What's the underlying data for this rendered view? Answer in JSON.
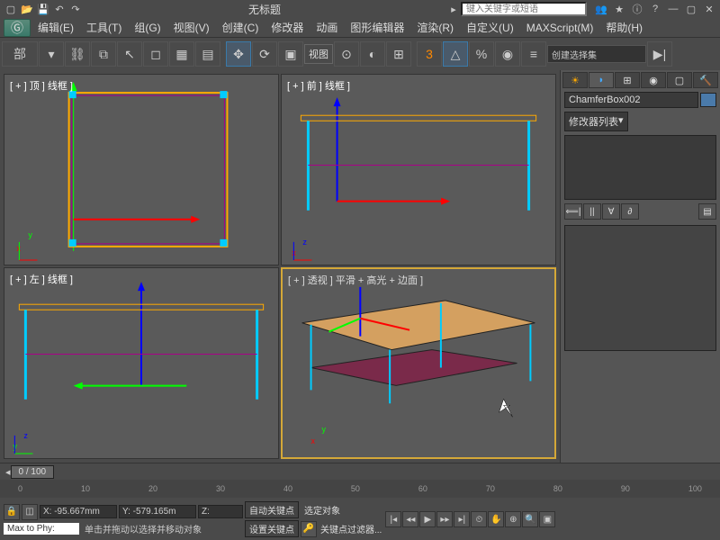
{
  "title": "无标题",
  "search_placeholder": "键入关键字或短语",
  "menus": [
    "编辑(E)",
    "工具(T)",
    "组(G)",
    "视图(V)",
    "创建(C)",
    "修改器",
    "动画",
    "图形编辑器",
    "渲染(R)",
    "自定义(U)",
    "MAXScript(M)",
    "帮助(H)"
  ],
  "toolbar_dropdown_label": "部",
  "view_label": "视图",
  "selection_set": "创建选择集",
  "viewports": {
    "top": "[ + ] 顶 ] 线框 ]",
    "front": "[ + ] 前 ] 线框 ]",
    "left": "[ + ] 左 ] 线框 ]",
    "persp": "[ + ] 透视 ] 平滑 + 高光 + 边面 ]"
  },
  "cmdpanel": {
    "object_name": "ChamferBox002",
    "modifier_list": "修改器列表"
  },
  "timeline": {
    "pos": "0 / 100",
    "ticks": [
      "0",
      "10",
      "20",
      "30",
      "40",
      "50",
      "60",
      "70",
      "80",
      "90",
      "100"
    ]
  },
  "status": {
    "x": "X: -95.667mm",
    "y": "Y: -579.165m",
    "z": "Z:",
    "script": "Max to Phy:",
    "prompt": "单击并拖动以选择并移动对象",
    "autokey": "自动关键点",
    "setkey": "设置关键点",
    "selected": "选定对象",
    "keyfilter": "关键点过滤器..."
  }
}
